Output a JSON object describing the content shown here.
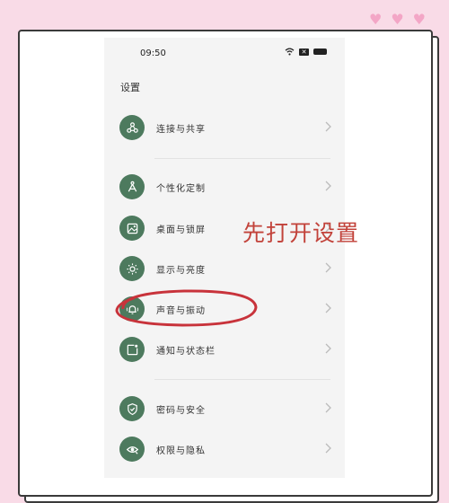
{
  "status_bar": {
    "time": "09:50"
  },
  "page": {
    "title": "设置"
  },
  "items": [
    {
      "label": "连接与共享",
      "icon": "share-nodes-icon"
    },
    {
      "label": "个性化定制",
      "icon": "pen-nib-icon"
    },
    {
      "label": "桌面与锁屏",
      "icon": "image-icon"
    },
    {
      "label": "显示与亮度",
      "icon": "sun-icon"
    },
    {
      "label": "声音与振动",
      "icon": "bell-icon"
    },
    {
      "label": "通知与状态栏",
      "icon": "notification-square-icon"
    },
    {
      "label": "密码与安全",
      "icon": "shield-icon"
    },
    {
      "label": "权限与隐私",
      "icon": "eye-shield-icon"
    }
  ],
  "annotation": {
    "text": "先打开设置",
    "color": "#c2423a"
  },
  "colors": {
    "icon_bg": "#4d7a5e",
    "page_bg": "#f9dbe7"
  }
}
